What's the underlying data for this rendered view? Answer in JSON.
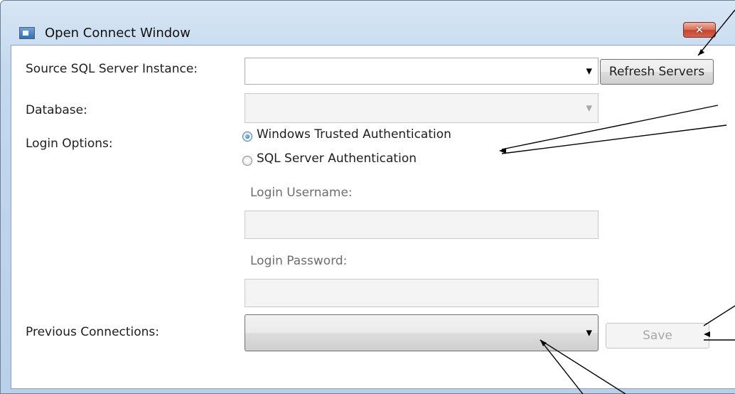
{
  "window": {
    "title": "Open Connect Window",
    "close_glyph": "✕"
  },
  "form": {
    "source_label": "Source SQL Server Instance:",
    "source_value": "",
    "refresh_label": "Refresh Servers",
    "database_label": "Database:",
    "database_value": "",
    "login_options_label": "Login Options:",
    "radio_windows": "Windows Trusted Authentication",
    "radio_sql": "SQL Server Authentication",
    "selected_login_option": "Windows Trusted Authentication",
    "username_label": "Login Username:",
    "username_value": "",
    "password_label": "Login Password:",
    "password_value": "",
    "previous_label": "Previous Connections:",
    "previous_value": "",
    "save_label": "Save"
  },
  "icons": {
    "app": "window-app-icon",
    "close": "close-icon",
    "dropdown": "chevron-down-icon"
  },
  "colors": {
    "titlebar": "#c4d8ee",
    "close_button": "#c2452f",
    "radio_checked": "#0d66b8"
  }
}
